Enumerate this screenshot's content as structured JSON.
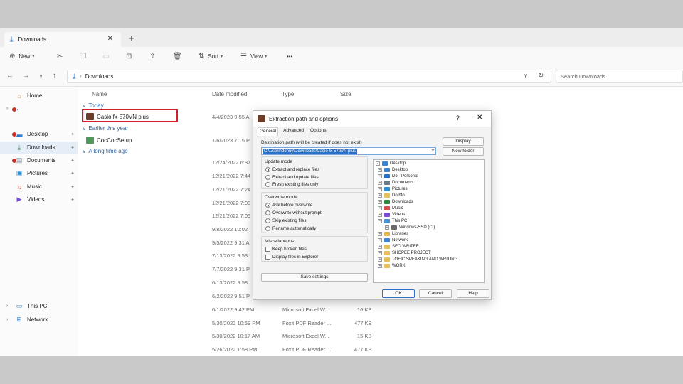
{
  "tab": {
    "title": "Downloads",
    "close": "✕",
    "new": "+"
  },
  "toolbar": {
    "new_label": "New",
    "sort_label": "Sort",
    "view_label": "View",
    "more": "•••"
  },
  "address": {
    "folder": "Downloads",
    "search_placeholder": "Search Downloads"
  },
  "sidebar": {
    "home": "Home",
    "desktop": "Desktop",
    "downloads": "Downloads",
    "documents": "Documents",
    "pictures": "Pictures",
    "music": "Music",
    "videos": "Videos",
    "thispc": "This PC",
    "network": "Network"
  },
  "columns": {
    "name": "Name",
    "date": "Date modified",
    "type": "Type",
    "size": "Size"
  },
  "groups": {
    "today": "Today",
    "earlier": "Earlier this year",
    "long": "A long time ago"
  },
  "files": {
    "casio": {
      "name": "Casio fx-570VN plus",
      "date": "4/4/2023 9:55 A"
    },
    "coccoc": {
      "name": "CocCocSetup",
      "date": "1/6/2023 7:15 P"
    }
  },
  "rows": [
    {
      "date": "12/24/2022 6:37",
      "type": "",
      "size": ""
    },
    {
      "date": "12/21/2022 7:44",
      "type": "",
      "size": ""
    },
    {
      "date": "12/21/2022 7:24",
      "type": "",
      "size": ""
    },
    {
      "date": "12/21/2022 7:03",
      "type": "",
      "size": ""
    },
    {
      "date": "12/21/2022 7:05",
      "type": "",
      "size": ""
    },
    {
      "date": "9/8/2022 10:02",
      "type": "",
      "size": ""
    },
    {
      "date": "9/5/2022 9:31 A",
      "type": "",
      "size": ""
    },
    {
      "date": "7/13/2022 9:53",
      "type": "",
      "size": ""
    },
    {
      "date": "7/7/2022 9:31 P",
      "type": "",
      "size": ""
    },
    {
      "date": "6/13/2022 9:58",
      "type": "",
      "size": ""
    },
    {
      "date": "6/2/2022 9:51 P",
      "type": "",
      "size": ""
    },
    {
      "date": "6/1/2022 9:42 PM",
      "type": "Microsoft Excel W...",
      "size": "16 KB"
    },
    {
      "date": "5/30/2022 10:59 PM",
      "type": "Foxit PDF Reader ...",
      "size": "477 KB"
    },
    {
      "date": "5/30/2022 10:17 AM",
      "type": "Microsoft Excel W...",
      "size": "15 KB"
    },
    {
      "date": "5/26/2022 1:58 PM",
      "type": "Foxit PDF Reader ...",
      "size": "477 KB"
    }
  ],
  "dialog": {
    "title": "Extraction path and options",
    "help_q": "?",
    "close": "✕",
    "tabs": {
      "general": "General",
      "advanced": "Advanced",
      "options": "Options"
    },
    "dest_label": "Destination path (will be created if does not exist)",
    "dest_value": "C:\\Users\\dohuy\\Downloads\\Casio fx-570VN plus",
    "display_btn": "Display",
    "newfolder_btn": "New folder",
    "update_mode": "Update mode",
    "update_opts": [
      "Extract and replace files",
      "Extract and update files",
      "Fresh existing files only"
    ],
    "overwrite_mode": "Overwrite mode",
    "overwrite_opts": [
      "Ask before overwrite",
      "Overwrite without prompt",
      "Skip existing files",
      "Rename automatically"
    ],
    "misc": "Miscellaneous",
    "misc_opts": [
      "Keep broken files",
      "Display files in Explorer"
    ],
    "save_btn": "Save settings",
    "ok": "OK",
    "cancel": "Cancel",
    "help": "Help",
    "tree": [
      {
        "label": "Desktop",
        "color": "#3a86d4"
      },
      {
        "label": "Desktop",
        "color": "#3a86d4"
      },
      {
        "label": "Do - Personal",
        "color": "#2a6fc4"
      },
      {
        "label": "Documents",
        "color": "#6d7b8a"
      },
      {
        "label": "Pictures",
        "color": "#2d8fd8"
      },
      {
        "label": "Do hfo",
        "color": "#e8c05a"
      },
      {
        "label": "Downloads",
        "color": "#2b8a3e"
      },
      {
        "label": "Music",
        "color": "#d94b4b"
      },
      {
        "label": "Videos",
        "color": "#7a4bd6"
      },
      {
        "label": "This PC",
        "color": "#4a8fd6"
      },
      {
        "label": "Windows-SSD (C:)",
        "color": "#6b6b6b"
      },
      {
        "label": "Libraries",
        "color": "#e0b648"
      },
      {
        "label": "Network",
        "color": "#3a86d4"
      },
      {
        "label": "SEO WRITER",
        "color": "#e8c05a"
      },
      {
        "label": "SHOPEE PROJECT",
        "color": "#e8c05a"
      },
      {
        "label": "TOEIC SPEAKING AND WRITING",
        "color": "#e8c05a"
      },
      {
        "label": "WORK",
        "color": "#e8c05a"
      }
    ]
  }
}
